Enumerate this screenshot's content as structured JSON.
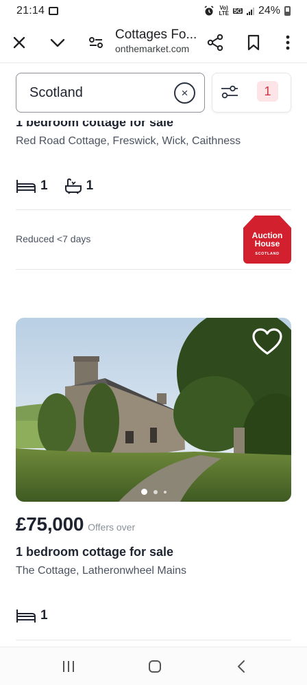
{
  "status_bar": {
    "time": "21:14",
    "net_top": "Vo)",
    "net_bottom": "LTE",
    "gen_top": "5G",
    "battery": "24%"
  },
  "toolbar": {
    "title": "Cottages Fo...",
    "url": "onthemarket.com"
  },
  "search": {
    "value": "Scotland",
    "clear_glyph": "×",
    "filter_count": "1"
  },
  "listing_1": {
    "title": "1 bedroom cottage for sale",
    "address": "Red Road Cottage, Freswick, Wick, Caithness",
    "beds": "1",
    "baths": "1",
    "reduced": "Reduced <7 days",
    "agent": {
      "line1": "Auction",
      "line2": "House",
      "line3": "SCOTLAND",
      "color": "#d3202f"
    }
  },
  "listing_2": {
    "price": "£75,000",
    "price_qualifier": "Offers over",
    "title": "1 bedroom cottage for sale",
    "address": "The Cottage, Latheronwheel Mains",
    "beds": "1",
    "photo_count": 3,
    "photo_index": 1
  },
  "colors": {
    "accent_red": "#d63242",
    "text_dark": "#1f2430",
    "text_muted": "#4b5260"
  }
}
